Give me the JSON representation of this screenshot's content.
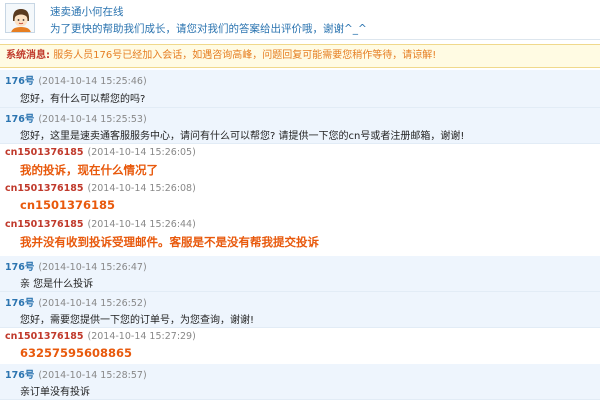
{
  "header": {
    "title": "速卖通小何在线",
    "subtitle": "为了更快的帮助我们成长，请您对我们的答案给出评价哦，谢谢^_^"
  },
  "system_notice": {
    "label": "系统消息:",
    "text": "服务人员176号已经加入会话，如遇咨询高峰，问题回复可能需要您稍作等待，请谅解!"
  },
  "messages": [
    {
      "sender": "176号",
      "time": "(2014-10-14 15:25:46)",
      "text": "您好，有什么可以帮您的吗?"
    },
    {
      "sender": "176号",
      "time": "(2014-10-14 15:25:53)",
      "text": "您好，这里是速卖通客服服务中心，请问有什么可以帮您? 请提供一下您的cn号或者注册邮箱，谢谢!"
    },
    {
      "sender": "cn1501376185",
      "time": "(2014-10-14 15:26:05)",
      "text": "我的投诉，现在什么情况了"
    },
    {
      "sender": "cn1501376185",
      "time": "(2014-10-14 15:26:08)",
      "text": "cn1501376185"
    },
    {
      "sender": "cn1501376185",
      "time": "(2014-10-14 15:26:44)",
      "text": "我并没有收到投诉受理邮件。客服是不是没有帮我提交投诉"
    },
    {
      "sender": "176号",
      "time": "(2014-10-14 15:26:47)",
      "text": "亲 您是什么投诉"
    },
    {
      "sender": "176号",
      "time": "(2014-10-14 15:26:52)",
      "text": "您好，需要您提供一下您的订单号，为您查询，谢谢!"
    },
    {
      "sender": "cn1501376185",
      "time": "(2014-10-14 15:27:29)",
      "text": "63257595608865"
    },
    {
      "sender": "176号",
      "time": "(2014-10-14 15:28:57)",
      "text": "亲订单没有投诉"
    }
  ]
}
